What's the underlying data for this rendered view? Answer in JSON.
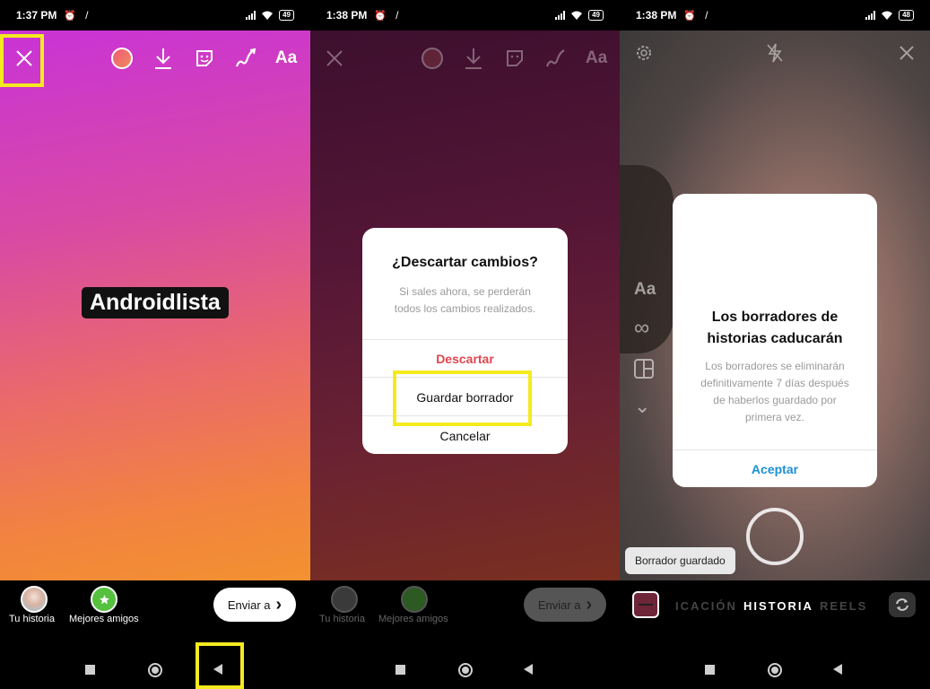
{
  "panel1": {
    "status": {
      "time": "1:37 PM",
      "alarm": "⏰",
      "slash": "/",
      "battery": "49"
    },
    "text_tag": "Androidlista",
    "share": {
      "your_story": "Tu historia",
      "close_friends": "Mejores amigos",
      "send_label": "Enviar a",
      "send_chevron": "›"
    },
    "toolbar": {
      "text_tool": "Aa"
    }
  },
  "panel2": {
    "status": {
      "time": "1:38 PM",
      "alarm": "⏰",
      "slash": "/",
      "battery": "49"
    },
    "toolbar": {
      "text_tool": "Aa"
    },
    "dialog": {
      "title": "¿Descartar cambios?",
      "message": "Si sales ahora, se perderán todos los cambios realizados.",
      "discard": "Descartar",
      "save_draft": "Guardar borrador",
      "cancel": "Cancelar"
    },
    "share": {
      "your_story": "Tu historia",
      "close_friends": "Mejores amigos",
      "send_label": "Enviar a",
      "send_chevron": "›"
    }
  },
  "panel3": {
    "status": {
      "time": "1:38 PM",
      "alarm": "⏰",
      "slash": "/",
      "battery": "48"
    },
    "side_tools": {
      "text": "Aa",
      "boomerang": "∞",
      "chevron": "⌄"
    },
    "dialog": {
      "title": "Los borradores de historias caducarán",
      "message": "Los borradores se eliminarán definitivamente 7 días después de haberlos guardado por primera vez.",
      "accept": "Aceptar"
    },
    "toast": "Borrador guardado",
    "modes": {
      "left": "ICACIÓN",
      "active": "HISTORIA",
      "right": "REELS"
    }
  },
  "colors": {
    "highlight": "#f4ea1f",
    "discard_red": "#e0454f",
    "accept_blue": "#1b8fd6"
  }
}
